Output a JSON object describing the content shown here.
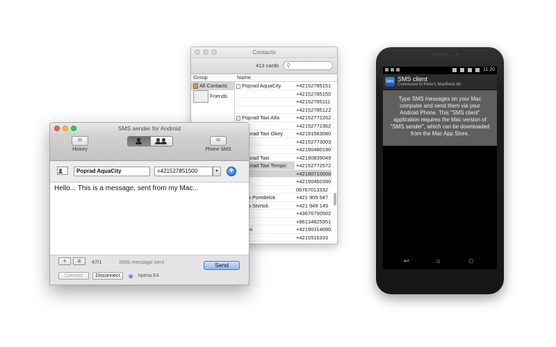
{
  "contacts_window": {
    "title": "Contacts",
    "card_count": "413 cards",
    "search_placeholder": "",
    "col_group": "Group",
    "col_name": "Name",
    "groups": [
      "All Contacts",
      "Friends"
    ],
    "names": [
      "Poprad AquaCity",
      "",
      "",
      "",
      "Poprad Taxi Alfa",
      "",
      "Poprad Taxi Okey",
      "",
      "",
      "Poprad Taxi",
      "Poprad Taxi Tempo",
      "",
      "",
      "anjal",
      "eprava Pomdelok",
      "eprava Stvrtok",
      "nqxia",
      "",
      "dio Taxi",
      ""
    ],
    "phones": [
      "+42152785151",
      "+42152785150",
      "+42152785111",
      "+42152785122",
      "+42152772262",
      "+42152772362",
      "+42191583080",
      "+42152773003",
      "+42190480190",
      "+42190839049",
      "+42152772572",
      "+42190710050",
      "+42190460390",
      "06767013332",
      "+421 905 547",
      "+421 949 149",
      "+43676790502",
      "+86134825951",
      "+42190314080",
      "+4215516333"
    ]
  },
  "sms_window": {
    "title": "SMS sender for Android",
    "history_label": "History",
    "phone_sms_label": "Phone SMS",
    "recipient_name": "Poprad AquaCity",
    "recipient_phone": "+421527851500",
    "message": "Hello... This is a message, sent from my Mac...",
    "add_label": "+",
    "list_label": "≡",
    "char_count": "47/1",
    "status": "SMS message sent",
    "send_label": "Send",
    "connect_label": "Connect",
    "disconnect_label": "Disconnect",
    "device_name": "Xperia E4"
  },
  "phone": {
    "time": "11:20",
    "notif_title": "SMS client",
    "notif_subtitle": "Connected to Peter's MacBook Air",
    "app_icon_text": "SMS",
    "card_text": "Type SMS messages on your Mac computer and send them via your Android Phone. This \"SMS client\" application requires the Mac version of \"SMS sender\", which can be downloaded from the Mac App Store."
  },
  "colors": {
    "send_button": "#8db7ef",
    "add_button": "#1f64d4",
    "phone_card": "#5f5f5f"
  }
}
